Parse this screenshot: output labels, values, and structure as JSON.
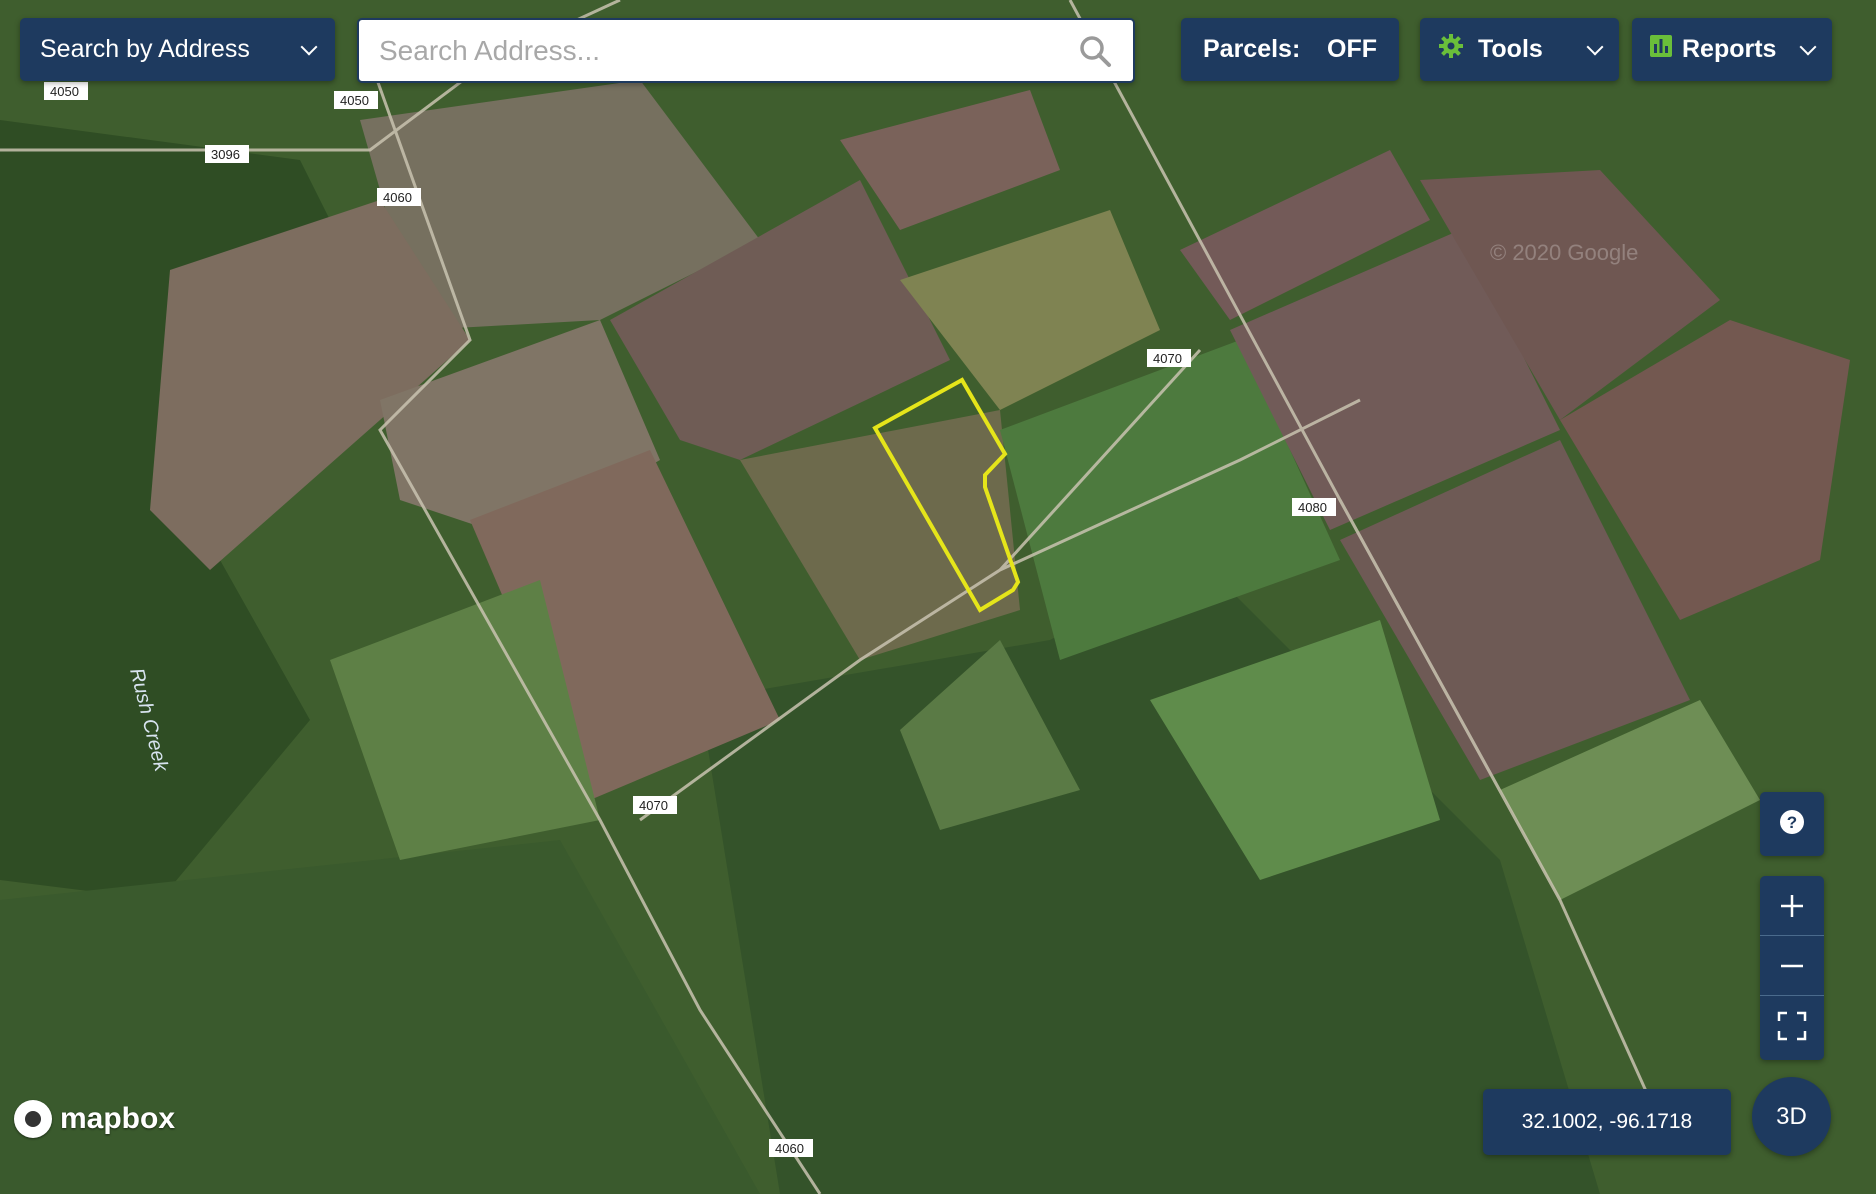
{
  "toolbar": {
    "search_mode": "Search by Address",
    "search_placeholder": "Search Address...",
    "search_value": "",
    "parcels_label": "Parcels:",
    "parcels_state": "OFF",
    "tools_label": "Tools",
    "reports_label": "Reports"
  },
  "map": {
    "road_labels": [
      "4050",
      "4050",
      "3096",
      "4060",
      "4070",
      "4080",
      "4070",
      "4060"
    ],
    "creek_label": "Rush Creek",
    "watermark": "© 2020 Google",
    "attribution": "mapbox"
  },
  "controls": {
    "coordinates": "32.1002, -96.1718",
    "three_d": "3D"
  },
  "colors": {
    "control_bg": "#1e3a5f",
    "parcel_outline": "#e5e51a",
    "tools_icon": "#6abf3a"
  },
  "icons": {
    "search": "search-icon",
    "tools": "gear-icon",
    "reports": "bar-chart-icon",
    "help": "question-icon",
    "zoom_in": "plus-icon",
    "zoom_out": "minus-icon",
    "fullscreen": "fullscreen-icon"
  }
}
